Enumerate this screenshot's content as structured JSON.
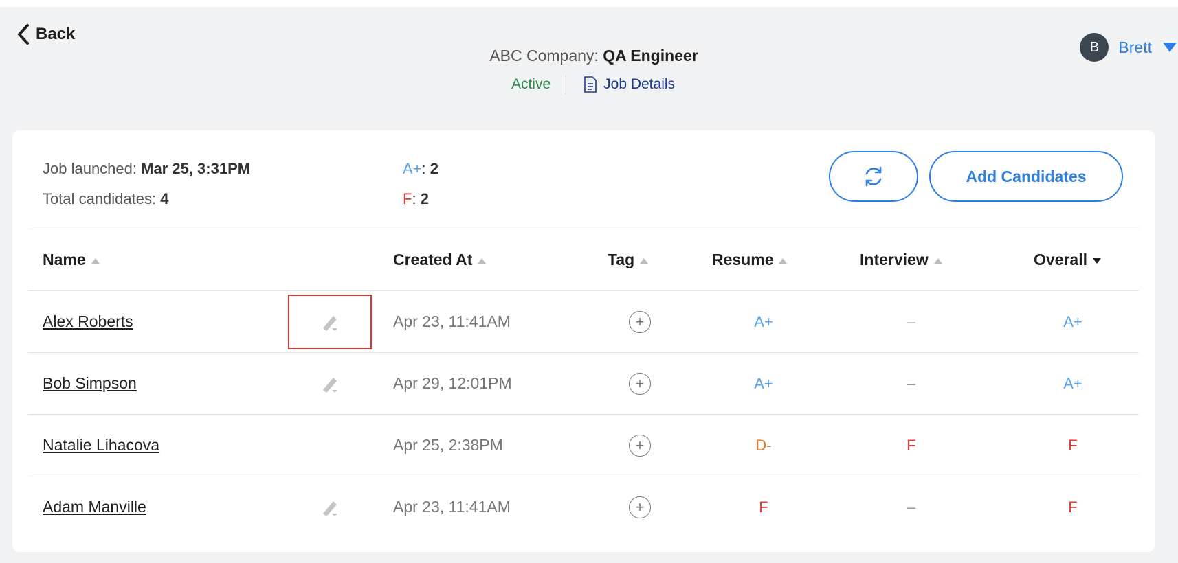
{
  "nav": {
    "back_label": "Back"
  },
  "job": {
    "company_prefix": "ABC Company:",
    "title": "QA Engineer",
    "status": "Active",
    "details_link": "Job Details"
  },
  "user": {
    "initial": "B",
    "name": "Brett"
  },
  "summary": {
    "launched_label": "Job launched:",
    "launched_value": "Mar 25, 3:31PM",
    "total_label": "Total candidates:",
    "total_value": "4",
    "grade_counts": [
      {
        "grade": "A+",
        "sep": ":",
        "count": "2"
      },
      {
        "grade": "F",
        "sep": ":",
        "count": "2"
      }
    ]
  },
  "actions": {
    "refresh_icon": "refresh-icon",
    "add_label": "Add Candidates"
  },
  "table": {
    "headers": {
      "name": "Name",
      "created_at": "Created At",
      "tag": "Tag",
      "resume": "Resume",
      "interview": "Interview",
      "overall": "Overall"
    },
    "rows": [
      {
        "name": "Alex Roberts",
        "created": "Apr 23, 11:41AM",
        "resume": "A+",
        "interview": "–",
        "overall": "A+",
        "has_edit": true
      },
      {
        "name": "Bob Simpson",
        "created": "Apr 29, 12:01PM",
        "resume": "A+",
        "interview": "–",
        "overall": "A+",
        "has_edit": true
      },
      {
        "name": "Natalie Lihacova",
        "created": "Apr 25, 2:38PM",
        "resume": "D-",
        "interview": "F",
        "overall": "F",
        "has_edit": false
      },
      {
        "name": "Adam Manville",
        "created": "Apr 23, 11:41AM",
        "resume": "F",
        "interview": "–",
        "overall": "F",
        "has_edit": true
      }
    ]
  },
  "colors": {
    "accent": "#2f7fe0",
    "grade_a_plus": "#5aa2e6",
    "grade_f": "#e03a3a",
    "grade_d_minus": "#e07a2a",
    "status_active": "#2e8b4a",
    "highlight_box": "#d93a32"
  }
}
